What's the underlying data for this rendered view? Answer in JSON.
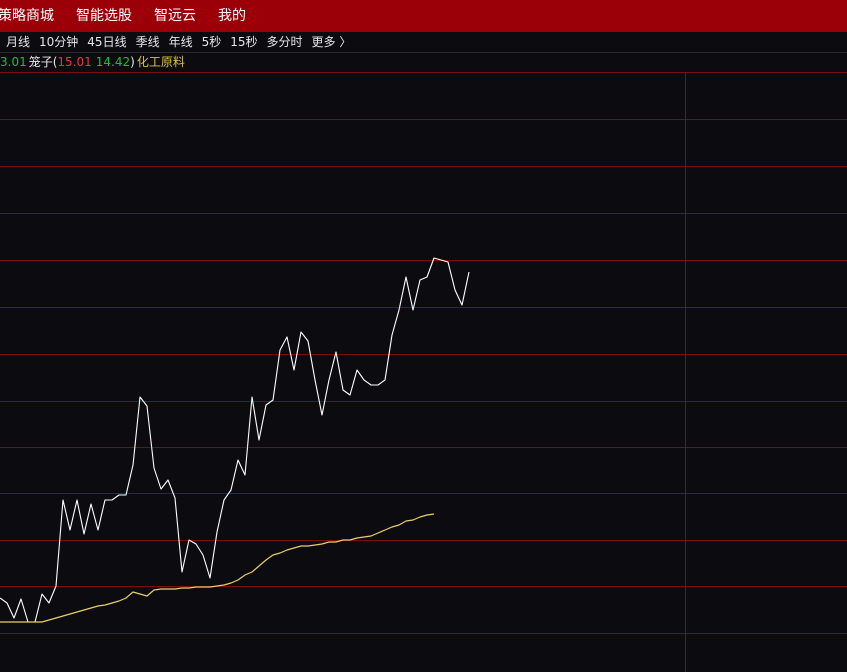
{
  "top_nav": {
    "items": [
      "策略商城",
      "智能选股",
      "智远云",
      "我的"
    ]
  },
  "period_tabs": {
    "items": [
      "月线",
      "10分钟",
      "45日线",
      "季线",
      "年线",
      "5秒",
      "15秒",
      "多分时"
    ],
    "more_label": "更多",
    "more_icon": "chevron-right-icon"
  },
  "legend": {
    "value_green_left": "3.01",
    "name": "笼子",
    "paren_open": "(",
    "value_red": "15.01",
    "value_green": "14.42",
    "paren_close": ")",
    "sector": "化工原料",
    "colors": {
      "green": "#1fbf2f",
      "red": "#e03a3a",
      "white": "#e6e6e6",
      "yellow": "#d8c23a"
    }
  },
  "colors": {
    "background": "#0c0c10",
    "top_bar": "#9b0009",
    "grid": "#7a0b10",
    "price_line": "#ffffff",
    "avg_line": "#e8cf6a"
  },
  "chart_data": {
    "type": "line",
    "x": [
      0,
      1,
      2,
      3,
      4,
      5,
      6,
      7,
      8,
      9,
      10,
      11,
      12,
      13,
      14,
      15,
      16,
      17,
      18,
      19,
      20,
      21,
      22,
      23,
      24,
      25,
      26,
      27,
      28,
      29,
      30,
      31,
      32,
      33,
      34,
      35,
      36,
      37,
      38,
      39,
      40,
      41,
      42,
      43,
      44,
      45,
      46,
      47,
      48,
      49,
      50,
      51,
      52,
      53,
      54,
      55,
      56,
      57,
      58,
      59,
      60,
      61,
      62,
      63,
      64,
      65,
      66,
      67,
      68,
      69,
      70,
      71
    ],
    "series": [
      {
        "values": [
          598,
          603,
          618,
          599,
          622,
          622,
          594,
          603,
          586,
          500,
          530,
          500,
          534,
          504,
          530,
          500,
          500,
          495,
          495,
          465,
          397,
          406,
          468,
          489,
          480,
          498,
          572,
          540,
          544,
          555,
          578,
          532,
          500,
          490,
          460,
          475,
          397,
          440,
          405,
          400,
          350,
          337,
          370,
          332,
          341,
          380,
          415,
          380,
          352,
          390,
          395,
          370,
          380,
          385,
          385,
          380,
          335,
          310,
          277,
          310,
          280,
          277,
          258,
          260,
          262,
          290,
          305,
          272,
          null,
          null,
          null,
          null
        ]
      },
      {
        "values": [
          622,
          622,
          622,
          622,
          622,
          622,
          622,
          620,
          618,
          616,
          614,
          612,
          610,
          608,
          606,
          605,
          603,
          601,
          598,
          592,
          594,
          596,
          590,
          589,
          589,
          589,
          588,
          588,
          587,
          587,
          587,
          586,
          585,
          583,
          580,
          575,
          572,
          566,
          560,
          555,
          553,
          550,
          548,
          546,
          546,
          545,
          544,
          542,
          542,
          540,
          540,
          538,
          537,
          536,
          533,
          530,
          527,
          525,
          521,
          520,
          517,
          515,
          514,
          null,
          null,
          null,
          null,
          null,
          null,
          null,
          null,
          null
        ]
      }
    ],
    "grid": true,
    "ylim": [
      672,
      72
    ]
  }
}
